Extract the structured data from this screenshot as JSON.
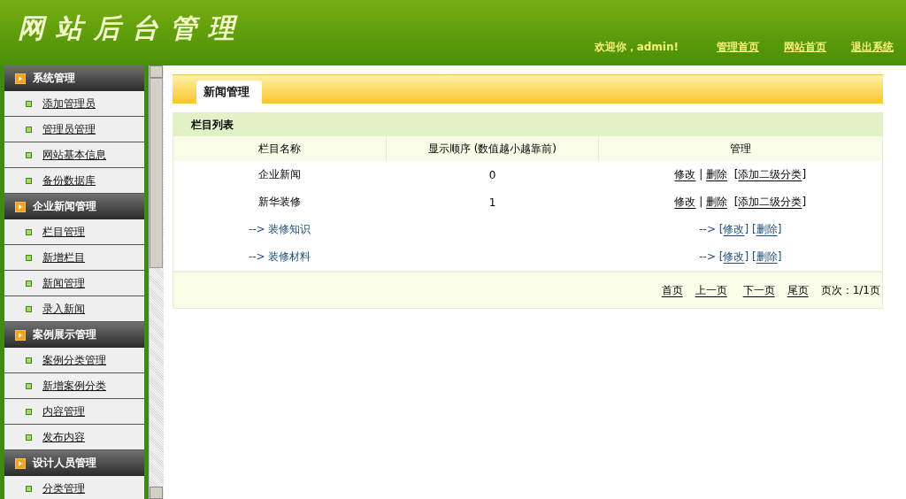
{
  "header": {
    "logo": "网站后台管理",
    "welcome": "欢迎你，admin!",
    "links": [
      "管理首页",
      "网站首页",
      "退出系统"
    ]
  },
  "sidebar": {
    "groups": [
      {
        "title": "系统管理",
        "items": [
          "添加管理员",
          "管理员管理",
          "网站基本信息",
          "备份数据库"
        ]
      },
      {
        "title": "企业新闻管理",
        "items": [
          "栏目管理",
          "新增栏目",
          "新闻管理",
          "录入新闻"
        ]
      },
      {
        "title": "案例展示管理",
        "items": [
          "案例分类管理",
          "新增案例分类",
          "内容管理",
          "发布内容"
        ]
      },
      {
        "title": "设计人员管理",
        "items": [
          "分类管理"
        ]
      }
    ]
  },
  "tabs": [
    {
      "label": "新闻管理",
      "selected": true
    }
  ],
  "table": {
    "title": "栏目列表",
    "columns": [
      "栏目名称",
      "显示顺序 (数值越小越靠前)",
      "管理"
    ],
    "rows": [
      {
        "kind": "top",
        "name": "企业新闻",
        "order": "0",
        "actions": [
          {
            "text": "修改",
            "link": true
          },
          {
            "text": " | ",
            "link": false
          },
          {
            "text": "删除",
            "link": true
          },
          {
            "text": "  [",
            "link": false
          },
          {
            "text": "添加二级分类",
            "link": true
          },
          {
            "text": "]",
            "link": false
          }
        ]
      },
      {
        "kind": "top",
        "name": "新华装修",
        "order": "1",
        "actions": [
          {
            "text": "修改",
            "link": true
          },
          {
            "text": " | ",
            "link": false
          },
          {
            "text": "删除",
            "link": true
          },
          {
            "text": "  [",
            "link": false
          },
          {
            "text": "添加二级分类",
            "link": true
          },
          {
            "text": "]",
            "link": false
          }
        ]
      },
      {
        "kind": "sub",
        "name": "--> 装修知识",
        "actions": [
          {
            "text": "--> [",
            "link": false
          },
          {
            "text": "修改",
            "link": true
          },
          {
            "text": "] [",
            "link": false
          },
          {
            "text": "删除",
            "link": true
          },
          {
            "text": "]",
            "link": false
          }
        ]
      },
      {
        "kind": "sub",
        "name": "--> 装修材料",
        "actions": [
          {
            "text": "--> [",
            "link": false
          },
          {
            "text": "修改",
            "link": true
          },
          {
            "text": "] [",
            "link": false
          },
          {
            "text": "删除",
            "link": true
          },
          {
            "text": "]",
            "link": false
          }
        ]
      }
    ],
    "pagination": {
      "links": [
        "首页",
        "上一页",
        "下一页",
        "尾页"
      ],
      "info": "页次：1/1页"
    }
  }
}
